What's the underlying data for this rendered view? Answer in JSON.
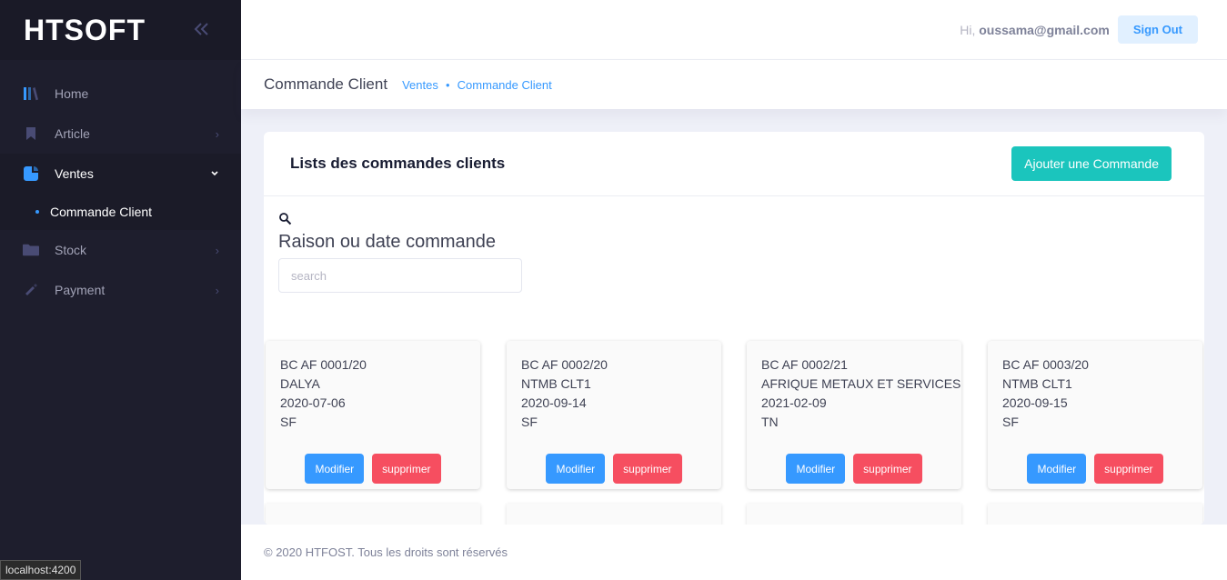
{
  "brand": {
    "logo": "HTSOFT",
    "toggle_icon": "double-chevron-left-icon"
  },
  "sidebar": {
    "items": [
      {
        "label": "Home",
        "icon": "library-icon"
      },
      {
        "label": "Article",
        "icon": "bookmark-icon"
      },
      {
        "label": "Ventes",
        "icon": "chart-pie-icon"
      },
      {
        "label": "Stock",
        "icon": "folder-icon"
      },
      {
        "label": "Payment",
        "icon": "pencil-icon"
      }
    ],
    "subitems": [
      {
        "label": "Commande Client"
      }
    ]
  },
  "header": {
    "greeting": "Hi,",
    "user_email": "oussama@gmail.com",
    "sign_out": "Sign Out"
  },
  "subheader": {
    "title": "Commande Client",
    "breadcrumb": [
      "Ventes",
      "Commande Client"
    ]
  },
  "card": {
    "title": "Lists des commandes clients",
    "add_button": "Ajouter une Commande",
    "search_label": "Raison ou date commande",
    "search_placeholder": "search"
  },
  "orders": [
    {
      "ref": "BC AF 0001/20",
      "client": "DALYA",
      "date": "2020-07-06",
      "code": "SF"
    },
    {
      "ref": "BC AF 0002/20",
      "client": "NTMB CLT1",
      "date": "2020-09-14",
      "code": "SF"
    },
    {
      "ref": "BC AF 0002/21",
      "client": "AFRIQUE METAUX ET SERVICES",
      "date": "2021-02-09",
      "code": "TN"
    },
    {
      "ref": "BC AF 0003/20",
      "client": "NTMB CLT1",
      "date": "2020-09-15",
      "code": "SF"
    }
  ],
  "order_actions": {
    "edit": "Modifier",
    "delete": "supprimer"
  },
  "footer": {
    "text": "© 2020 HTFOST. Tous les droits sont réservés"
  },
  "status_url": "localhost:4200",
  "colors": {
    "sidebar_bg": "#1e1e2d",
    "primary": "#3699ff",
    "success": "#1bc5bd",
    "danger": "#f64e60"
  }
}
